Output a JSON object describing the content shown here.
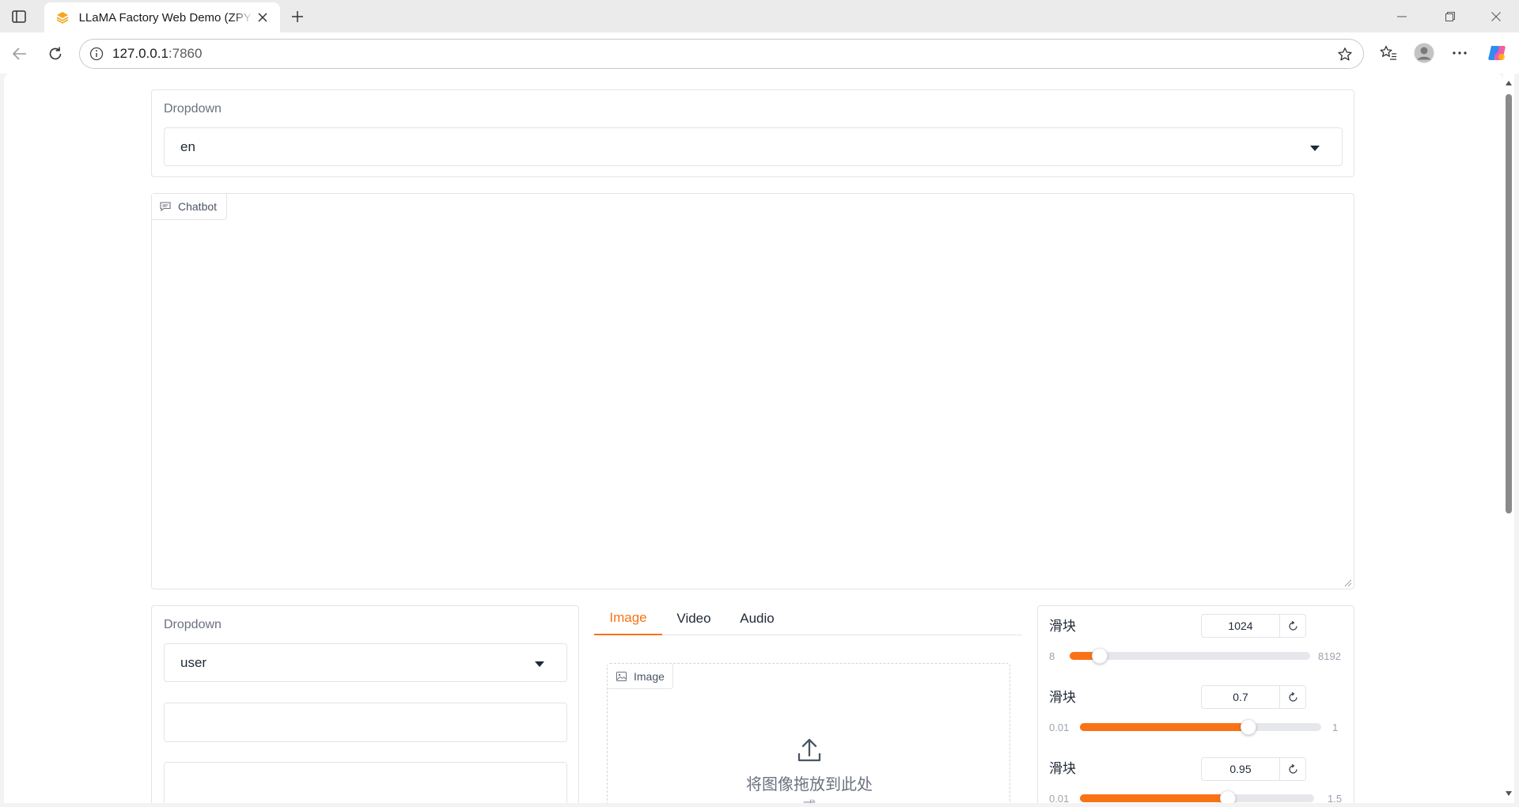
{
  "browser": {
    "tab_title": "LLaMA Factory Web Demo (ZPYSoftware)",
    "url_host": "127.0.0.1",
    "url_port": ":7860"
  },
  "page": {
    "lang_dropdown": {
      "label": "Dropdown",
      "value": "en"
    },
    "chatbot": {
      "label": "Chatbot"
    },
    "role_dropdown": {
      "label": "Dropdown",
      "value": "user"
    },
    "media_tabs": [
      {
        "label": "Image",
        "active": true
      },
      {
        "label": "Video",
        "active": false
      },
      {
        "label": "Audio",
        "active": false
      }
    ],
    "image_upload": {
      "label": "Image",
      "drop_text": "将图像拖放到此处",
      "or_text": "或"
    },
    "sliders": [
      {
        "label": "滑块",
        "value": "1024",
        "min": "8",
        "max": "8192",
        "fraction": 0.124
      },
      {
        "label": "滑块",
        "value": "0.7",
        "min": "0.01",
        "max": "1",
        "fraction": 0.697
      },
      {
        "label": "滑块",
        "value": "0.95",
        "min": "0.01",
        "max": "1.5",
        "fraction": 0.631
      }
    ],
    "accent_color": "#f97316"
  }
}
